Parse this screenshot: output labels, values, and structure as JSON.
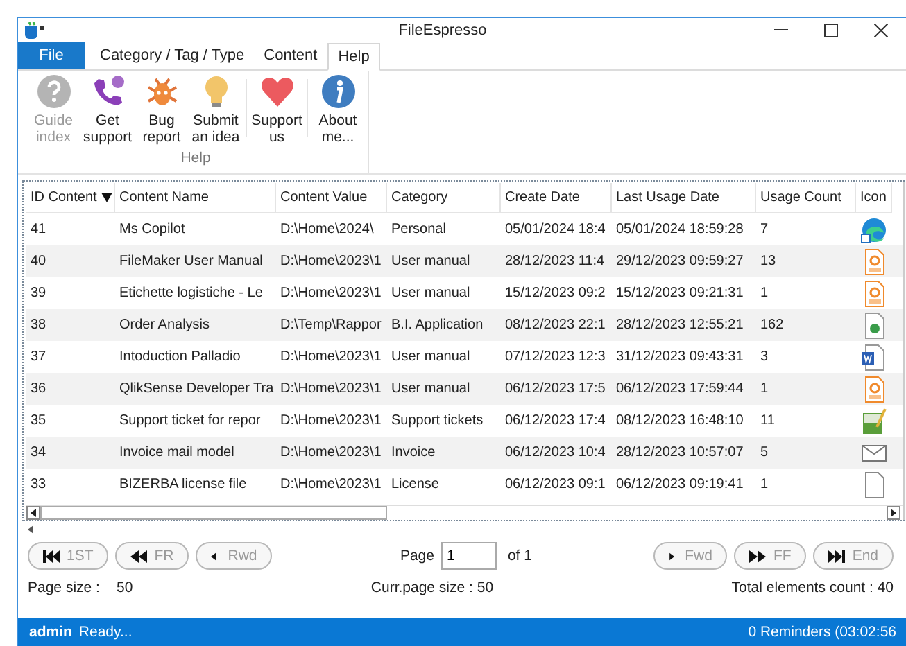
{
  "window": {
    "title": "FileEspresso"
  },
  "menu_tabs": [
    {
      "label": "File",
      "kind": "file",
      "selected": false
    },
    {
      "label": "Category / Tag / Type",
      "kind": "tab",
      "selected": false
    },
    {
      "label": "Content",
      "kind": "tab",
      "selected": false
    },
    {
      "label": "Help",
      "kind": "tab",
      "selected": true
    }
  ],
  "ribbon": {
    "group_label": "Help",
    "clusters": [
      [
        {
          "label": "Guide index",
          "kind": "question",
          "disabled": true
        },
        {
          "label": "Get support",
          "kind": "phone",
          "disabled": false
        },
        {
          "label": "Bug report",
          "kind": "bug",
          "disabled": false
        },
        {
          "label": "Submit an idea",
          "kind": "bulb",
          "disabled": false
        }
      ],
      [
        {
          "label": "Support us",
          "kind": "heart",
          "disabled": false
        }
      ],
      [
        {
          "label": "About me...",
          "kind": "info",
          "disabled": false
        }
      ]
    ]
  },
  "table": {
    "columns": [
      {
        "label": "ID Content",
        "sorted": true
      },
      {
        "label": "Content Name",
        "sorted": false
      },
      {
        "label": "Content Value",
        "sorted": false
      },
      {
        "label": "Category",
        "sorted": false
      },
      {
        "label": "Create Date",
        "sorted": false
      },
      {
        "label": "Last Usage Date",
        "sorted": false
      },
      {
        "label": "Usage Count",
        "sorted": false
      },
      {
        "label": "Icon",
        "sorted": false
      }
    ],
    "rows": [
      {
        "cells": [
          "41",
          "Ms Copilot",
          "D:\\Home\\2024\\",
          "Personal",
          "05/01/2024 18:4",
          "05/01/2024 18:59:28",
          "7"
        ],
        "kind": "edge"
      },
      {
        "cells": [
          "40",
          "FileMaker User Manual",
          "D:\\Home\\2023\\1",
          "User manual",
          "28/12/2023 11:4",
          "29/12/2023 09:59:27",
          "13"
        ],
        "kind": "pdf"
      },
      {
        "cells": [
          "39",
          "Etichette logistiche - Le",
          "D:\\Home\\2023\\1",
          "User manual",
          "15/12/2023 09:2",
          "15/12/2023 09:21:31",
          "1"
        ],
        "kind": "pdf"
      },
      {
        "cells": [
          "38",
          "Order Analysis",
          "D:\\Temp\\Rappor",
          "B.I. Application",
          "08/12/2023 22:1",
          "28/12/2023 12:55:21",
          "162"
        ],
        "kind": "qlik"
      },
      {
        "cells": [
          "37",
          "Intoduction Palladio",
          "D:\\Home\\2023\\1",
          "User manual",
          "07/12/2023 12:3",
          "31/12/2023 09:43:31",
          "3"
        ],
        "kind": "word"
      },
      {
        "cells": [
          "36",
          "QlikSense Developer Tra",
          "D:\\Home\\2023\\1",
          "User manual",
          "06/12/2023 17:5",
          "06/12/2023 17:59:44",
          "1"
        ],
        "kind": "pdf"
      },
      {
        "cells": [
          "35",
          "Support ticket for repor",
          "D:\\Home\\2023\\1",
          "Support tickets",
          "06/12/2023 17:4",
          "08/12/2023 16:48:10",
          "11"
        ],
        "kind": "sheet"
      },
      {
        "cells": [
          "34",
          "Invoice mail model",
          "D:\\Home\\2023\\1",
          "Invoice",
          "06/12/2023 10:4",
          "28/12/2023 10:57:07",
          "5"
        ],
        "kind": "mail"
      },
      {
        "cells": [
          "33",
          "BIZERBA license file",
          "D:\\Home\\2023\\1",
          "License",
          "06/12/2023 09:1",
          "06/12/2023 09:19:41",
          "1"
        ],
        "kind": "file"
      }
    ]
  },
  "pager": {
    "nav_left": [
      {
        "label": "1ST",
        "kind": "first",
        "disabled": true
      },
      {
        "label": "FR",
        "kind": "rewind",
        "disabled": true
      },
      {
        "label": "Rwd",
        "kind": "prev",
        "disabled": true
      }
    ],
    "page_label": "Page",
    "page_value": "1",
    "of_label": "of 1",
    "nav_right": [
      {
        "label": "Fwd",
        "kind": "next",
        "disabled": true
      },
      {
        "label": "FF",
        "kind": "ff",
        "disabled": true
      },
      {
        "label": "End",
        "kind": "last",
        "disabled": true
      }
    ],
    "page_size_label": "Page size :",
    "page_size_value": "50",
    "curr_page_size": "Curr.page size : 50",
    "total": "Total elements count : 40"
  },
  "status_bar": {
    "user": "admin",
    "message": "Ready...",
    "reminders": "0 Reminders (03:02:56"
  }
}
